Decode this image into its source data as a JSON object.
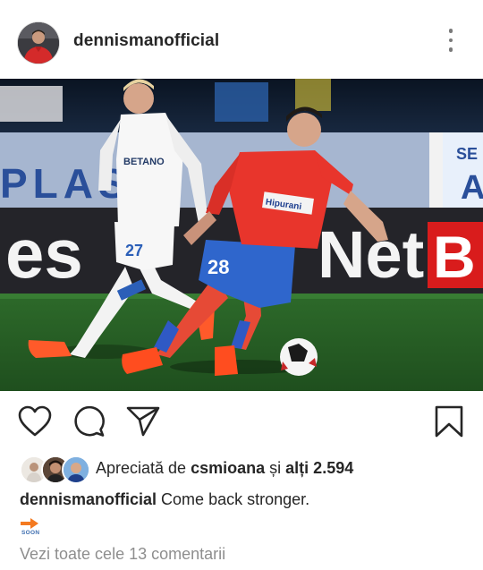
{
  "post": {
    "username": "dennismanofficial",
    "avatar_icon": "profile-avatar",
    "more_icon": "more-vertical-icon"
  },
  "photo": {
    "banner_left": "PLAS",
    "banner_right_top": "SE",
    "banner_right_bottom": "A",
    "board_left": "es",
    "board_right": "Net",
    "board_right_b": "B",
    "white_shirt_sponsor": "BETANO",
    "white_number": "27",
    "red_shirt_sponsor": "Hipurani",
    "red_number": "28"
  },
  "actions": {
    "like_icon": "heart-icon",
    "comment_icon": "comment-icon",
    "share_icon": "send-icon",
    "save_icon": "bookmark-icon"
  },
  "likes": {
    "prefix": "Apreciată de",
    "user": "csmioana",
    "connector": "și",
    "others": "alți 2.594"
  },
  "caption": {
    "username": "dennismanofficial",
    "text": "Come back stronger."
  },
  "soon": {
    "label": "SOON",
    "arrow_color": "#f47a20"
  },
  "comments": {
    "view_all": "Vezi toate cele 13 comentarii"
  }
}
